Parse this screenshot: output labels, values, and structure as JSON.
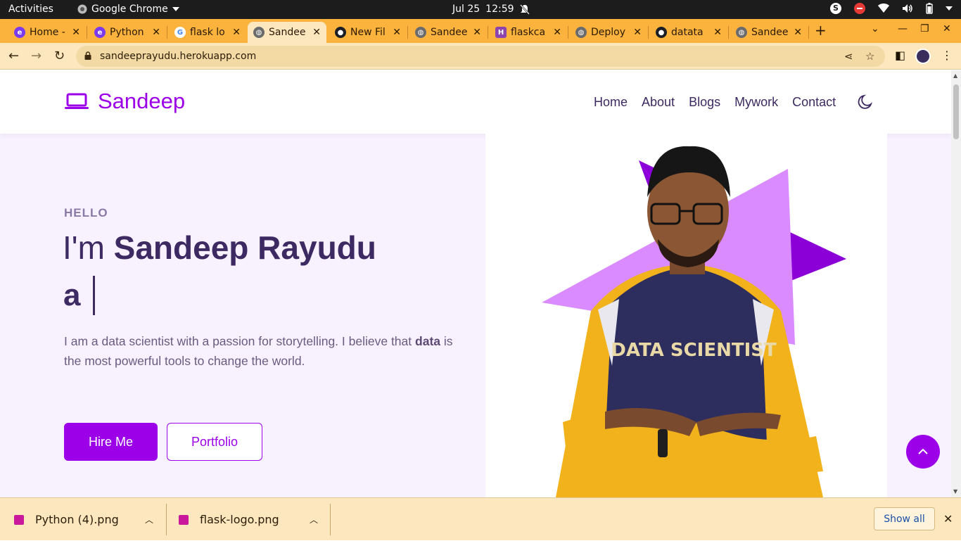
{
  "system_bar": {
    "activities": "Activities",
    "app_name": "Google Chrome",
    "date": "Jul 25",
    "time": "12:59"
  },
  "tabs": [
    {
      "title": "Home -",
      "favicon": "edge-icon",
      "active": false
    },
    {
      "title": "Python",
      "favicon": "edge-icon",
      "active": false
    },
    {
      "title": "flask lo",
      "favicon": "google-icon",
      "active": false
    },
    {
      "title": "Sandee",
      "favicon": "globe-icon",
      "active": true
    },
    {
      "title": "New Fil",
      "favicon": "github-icon",
      "active": false
    },
    {
      "title": "Sandee",
      "favicon": "globe-icon",
      "active": false
    },
    {
      "title": "flaskca",
      "favicon": "heroku-icon",
      "active": false
    },
    {
      "title": "Deploy",
      "favicon": "globe-icon",
      "active": false
    },
    {
      "title": "datata",
      "favicon": "github-icon",
      "active": false
    },
    {
      "title": "Sandee",
      "favicon": "globe-icon",
      "active": false
    }
  ],
  "address_bar": {
    "url": "sandeeprayudu.herokuapp.com"
  },
  "site": {
    "brand": "Sandeep",
    "nav": [
      "Home",
      "About",
      "Blogs",
      "Mywork",
      "Contact"
    ],
    "hero": {
      "greeting": "HELLO",
      "intro_prefix": "I'm",
      "name": "Sandeep Rayudu",
      "typed_prefix": "a",
      "description_part1": "I am a data scientist with a passion for storytelling. I believe that",
      "description_bold": "data",
      "description_part2": "is the most powerful tools to change the world.",
      "primary_button": "Hire Me",
      "secondary_button": "Portfolio",
      "photo_shirt_text": "DATA SCIENTIST"
    }
  },
  "downloads": {
    "items": [
      "Python (4).png",
      "flask-logo.png"
    ],
    "show_all": "Show all"
  },
  "colors": {
    "accent": "#9b00e8",
    "chrome_tabstrip": "#fcb33d",
    "chrome_toolbar": "#fde7bf",
    "heading": "#3d2a62"
  }
}
